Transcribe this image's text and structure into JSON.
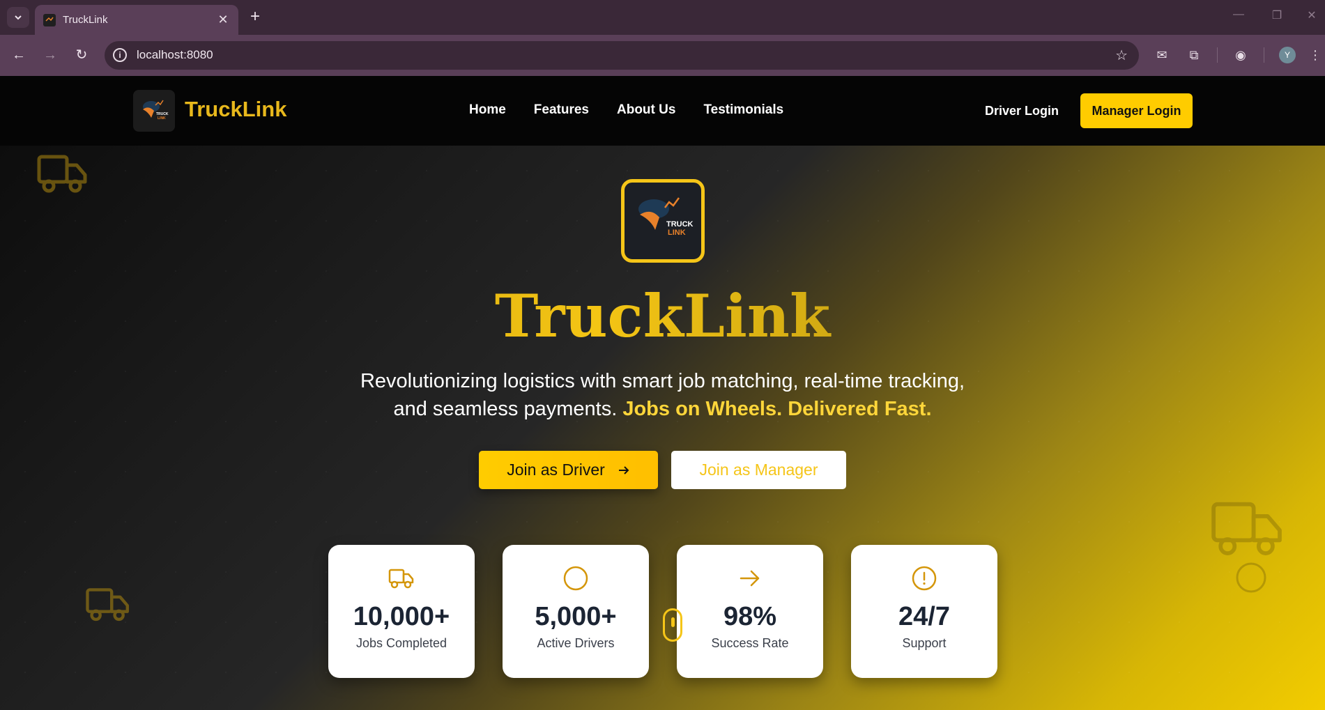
{
  "browser": {
    "tab_title": "TruckLink",
    "url": "localhost:8080",
    "profile_initial": "Y"
  },
  "header": {
    "brand": "TruckLink",
    "nav": [
      {
        "label": "Home"
      },
      {
        "label": "Features"
      },
      {
        "label": "About Us"
      },
      {
        "label": "Testimonials"
      }
    ],
    "driver_login": "Driver Login",
    "manager_login": "Manager Login"
  },
  "hero": {
    "logo_text_top": "TRUCK",
    "logo_text_bottom": "LINK",
    "title": "TruckLink",
    "tagline_line1": "Revolutionizing logistics with smart job matching, real-time tracking,",
    "tagline_line2": "and seamless payments.",
    "tagline_accent": "Jobs on Wheels. Delivered Fast.",
    "cta_driver": "Join as Driver",
    "cta_manager": "Join as Manager"
  },
  "stats": [
    {
      "icon": "truck-icon",
      "value": "10,000+",
      "label": "Jobs Completed"
    },
    {
      "icon": "circle-icon",
      "value": "5,000+",
      "label": "Active Drivers"
    },
    {
      "icon": "arrow-right-icon",
      "value": "98%",
      "label": "Success Rate"
    },
    {
      "icon": "alert-circle-icon",
      "value": "24/7",
      "label": "Support"
    }
  ],
  "colors": {
    "accent": "#ffcc00",
    "header_bg": "#050505",
    "stat_icon": "#d4960a",
    "browser_frame": "#5a3f58"
  }
}
